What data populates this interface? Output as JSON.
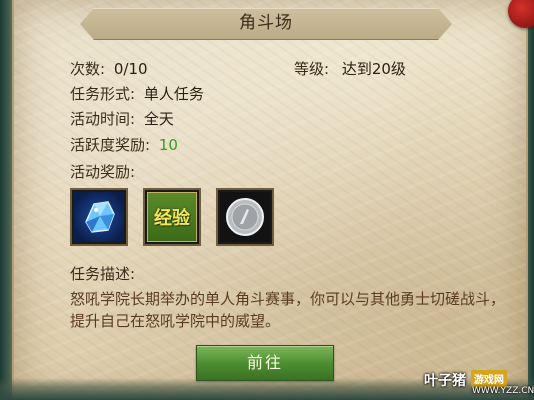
{
  "title": "角斗场",
  "info": {
    "count_label": "次数:",
    "count_value": "0/10",
    "level_label": "等级:",
    "level_value": "达到20级",
    "form_label": "任务形式:",
    "form_value": "单人任务",
    "time_label": "活动时间:",
    "time_value": "全天",
    "activity_label": "活跃度奖励:",
    "activity_value": "10",
    "rewards_label": "活动奖励:"
  },
  "rewards": [
    {
      "name": "blue-crystal",
      "icon": "crystal-icon"
    },
    {
      "name": "experience",
      "text": "经验",
      "icon": "exp-icon"
    },
    {
      "name": "silver-coin",
      "icon": "coin-icon"
    }
  ],
  "description": {
    "label": "任务描述:",
    "text": "怒吼学院长期举办的单人角斗赛事，你可以与其他勇士切磋战斗，提升自己在怒吼学院中的威望。"
  },
  "go_button": "前往",
  "watermark": {
    "brand": "叶子猪",
    "badge": "游戏网",
    "url": "WWW.YZZ.CN"
  },
  "colors": {
    "accent_green": "#3a9a24",
    "button_green": "#4e8f32",
    "seal_red": "#c42a24"
  }
}
